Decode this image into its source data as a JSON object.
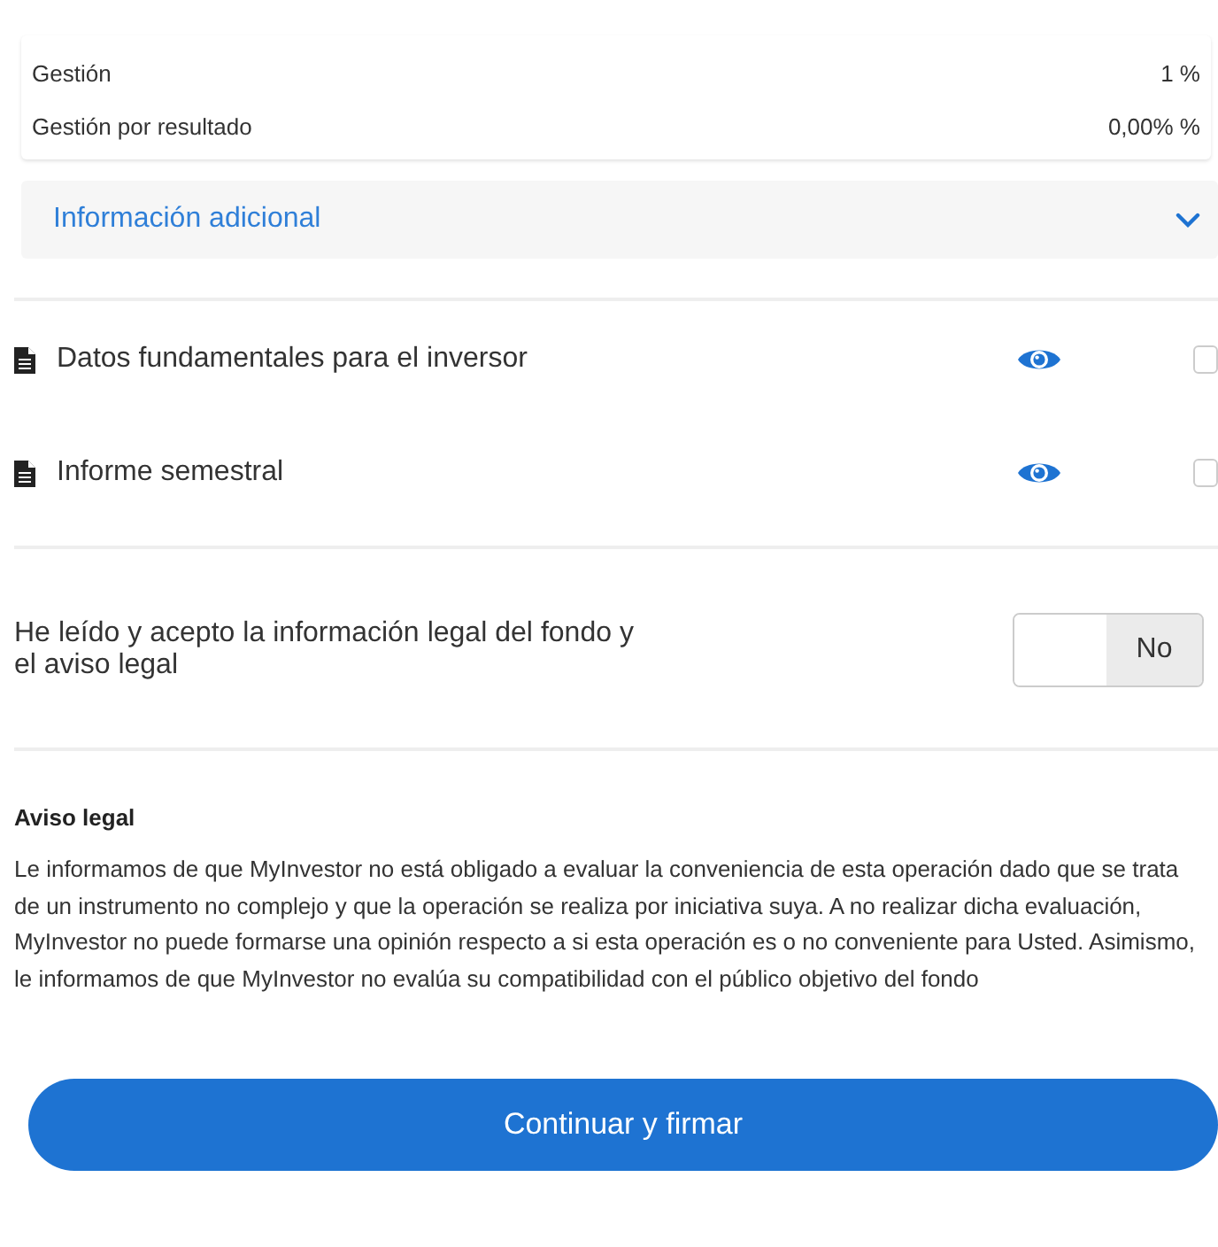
{
  "fees": [
    {
      "label": "Gestión",
      "value": "1 %"
    },
    {
      "label": "Gestión por resultado",
      "value": "0,00% %"
    }
  ],
  "additional_info": {
    "label": "Información adicional",
    "expanded": false
  },
  "documents": [
    {
      "name": "Datos fundamentales para el inversor",
      "checked": false
    },
    {
      "name": "Informe semestral",
      "checked": false
    }
  ],
  "legal_acceptance": {
    "label": "He leído y acepto la información legal del fondo y el aviso legal",
    "toggle_label": "No",
    "on": false
  },
  "legal_notice": {
    "title": "Aviso legal",
    "text": "Le informamos de que MyInvestor no está obligado a evaluar la conveniencia de esta operación dado que se trata de un instrumento no complejo y que la operación se realiza por iniciativa suya. A no realizar dicha evaluación, MyInvestor no puede formarse una opinión respecto a si esta operación es o no conveniente para Usted. Asimismo, le informamos de que MyInvestor no evalúa su compatibilidad con el público objetivo del fondo"
  },
  "submit_button": "Continuar y firmar"
}
